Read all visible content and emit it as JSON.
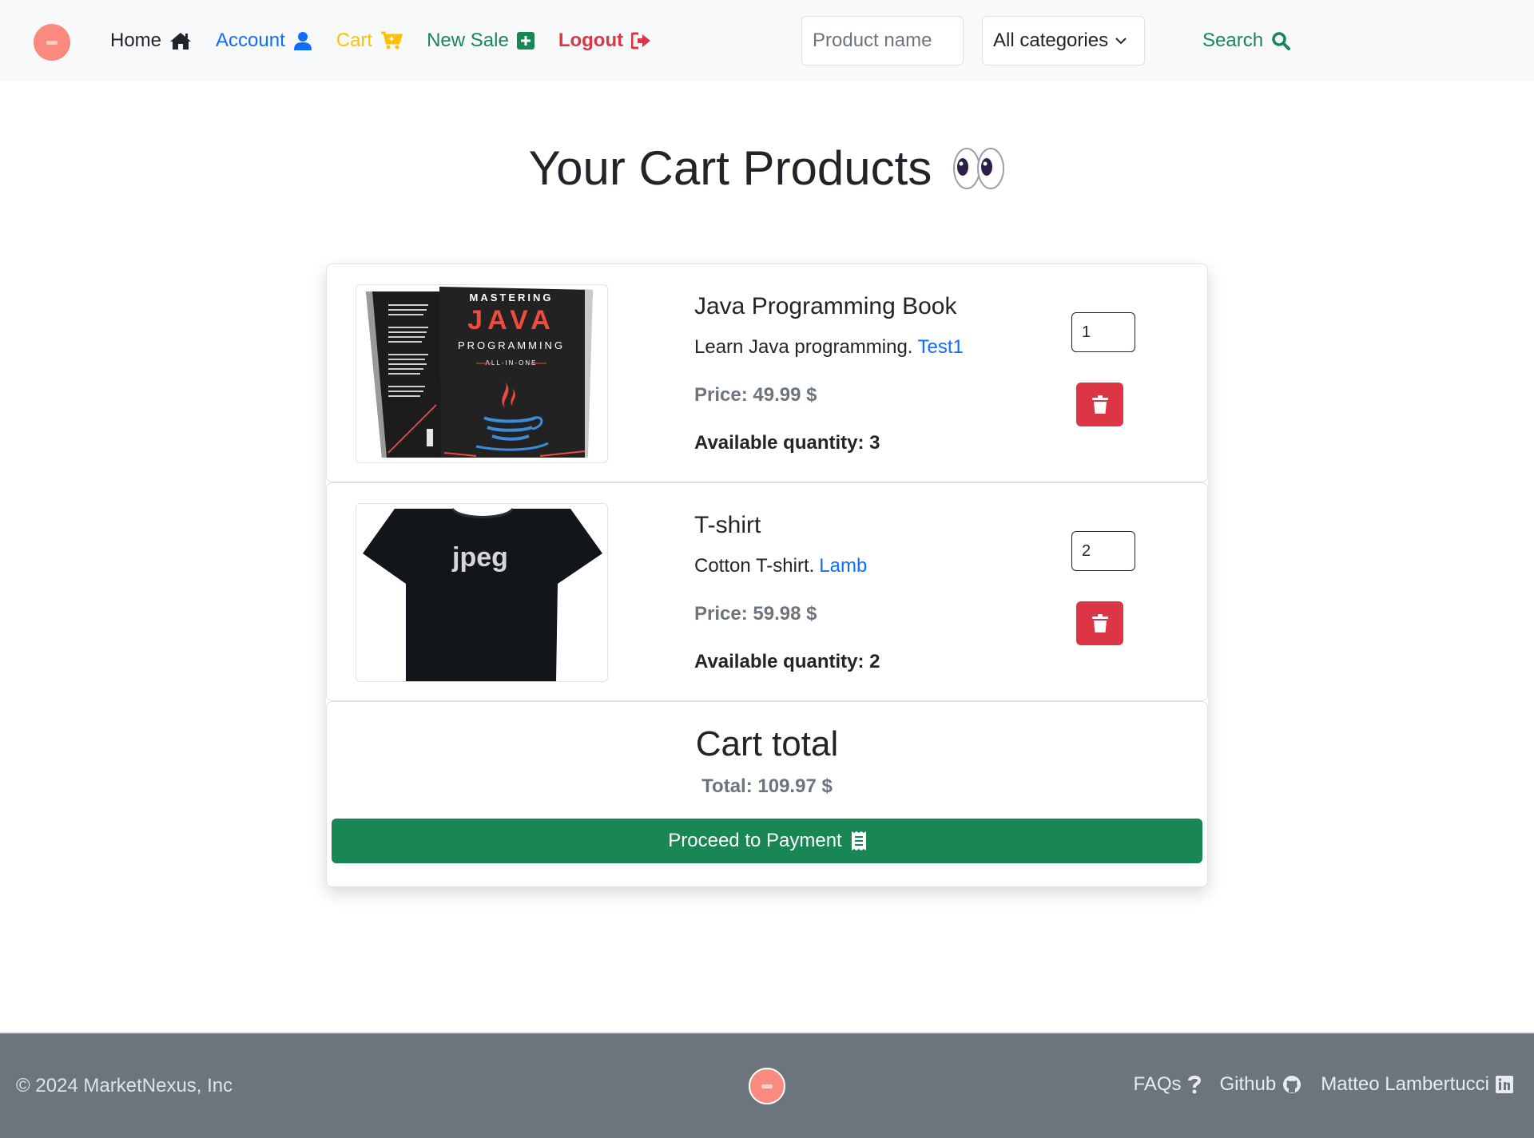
{
  "nav": {
    "logo_icon": "marketnexus-logo-icon",
    "links": [
      {
        "label": "Home",
        "icon": "home-icon",
        "color": "#212529"
      },
      {
        "label": "Account",
        "icon": "user-icon",
        "color": "#0d6efd"
      },
      {
        "label": "Cart",
        "icon": "cart-icon",
        "color": "#ffc107"
      },
      {
        "label": "New Sale",
        "icon": "plus-square-icon",
        "color": "#198754"
      },
      {
        "label": "Logout",
        "icon": "logout-icon",
        "color": "#dc3545"
      }
    ],
    "search_placeholder": "Product name",
    "category_selected": "All categories",
    "search_label": "Search"
  },
  "main": {
    "title": "Your Cart Products",
    "title_icon": "eyes-emoji-icon",
    "items": [
      {
        "name": "Java Programming Book",
        "description": "Learn Java programming.",
        "seller": "Test1",
        "price": "Price: 49.99 $",
        "available": "Available quantity: 3",
        "quantity": "1",
        "image_icon": "java-book-image",
        "cover_mastering": "MASTERING",
        "cover_java": "JAVA",
        "cover_programming": "PROGRAMMING",
        "cover_allinone": "ALL-IN-ONE"
      },
      {
        "name": "T-shirt",
        "description": "Cotton T-shirt.",
        "seller": "Lamb",
        "price": "Price: 59.98 $",
        "available": "Available quantity: 2",
        "quantity": "2",
        "image_icon": "tshirt-image",
        "shirt_text": "jpeg"
      }
    ],
    "total": {
      "title": "Cart total",
      "value": "Total: 109.97 $",
      "pay_label": "Proceed to Payment",
      "pay_icon": "receipt-icon"
    }
  },
  "footer": {
    "copyright": "© 2024 MarketNexus, Inc",
    "links": [
      {
        "label": "FAQs",
        "icon": "question-icon"
      },
      {
        "label": "Github",
        "icon": "github-icon"
      },
      {
        "label": "Matteo Lambertucci",
        "icon": "linkedin-icon"
      }
    ]
  },
  "colors": {
    "primary": "#0d6efd",
    "success": "#198754",
    "danger": "#dc3545",
    "warning": "#ffc107",
    "muted": "#6c757d",
    "logo": "#fa8a7e"
  }
}
